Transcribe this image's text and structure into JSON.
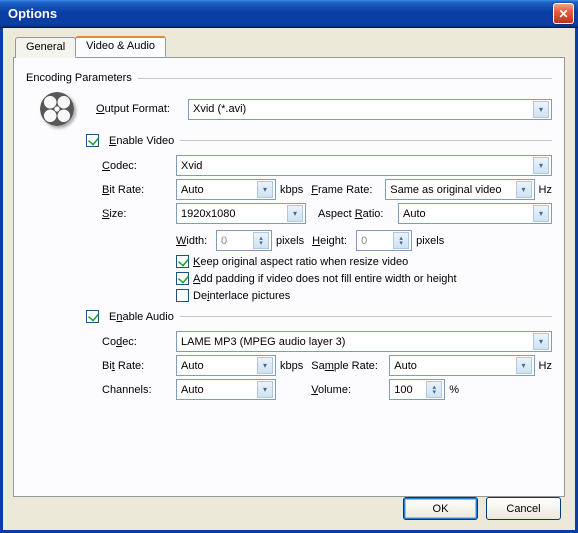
{
  "title": "Options",
  "tabs": {
    "general": "General",
    "video_audio": "Video & Audio"
  },
  "group_encoding": "Encoding Parameters",
  "output_format": {
    "label": "Output Format:",
    "value": "Xvid (*.avi)",
    "u": "O"
  },
  "video": {
    "enable": "Enable Video",
    "u_enable": "E",
    "codec": {
      "label": "Codec:",
      "value": "Xvid",
      "u": "C"
    },
    "bitrate": {
      "label": "Bit Rate:",
      "value": "Auto",
      "unit": "kbps",
      "u": "B"
    },
    "framerate": {
      "label": "Frame Rate:",
      "value": "Same as original video",
      "unit": "Hz",
      "u": "F"
    },
    "size": {
      "label": "Size:",
      "value": "1920x1080",
      "u": "S"
    },
    "aspect": {
      "label": "Aspect Ratio:",
      "value": "Auto",
      "u": "R"
    },
    "width": {
      "label": "Width:",
      "value": "0",
      "unit": "pixels",
      "u": "W"
    },
    "height": {
      "label": "Height:",
      "value": "0",
      "unit": "pixels",
      "u": "H"
    },
    "keep_ratio": "Keep original aspect ratio when resize video",
    "u_keep": "K",
    "add_padding": "Add padding if video does not fill entire width or height",
    "u_pad": "A",
    "deinterlace": "Deinterlace pictures",
    "u_dei": "i"
  },
  "audio": {
    "enable": "Enable Audio",
    "u_enable": "n",
    "codec": {
      "label": "Codec:",
      "value": "LAME MP3 (MPEG audio layer 3)",
      "u": "d"
    },
    "bitrate": {
      "label": "Bit Rate:",
      "value": "Auto",
      "unit": "kbps",
      "u": "t"
    },
    "samplerate": {
      "label": "Sample Rate:",
      "value": "Auto",
      "unit": "Hz",
      "u": "m"
    },
    "channels": {
      "label": "Channels:",
      "value": "Auto"
    },
    "volume": {
      "label": "Volume:",
      "value": "100",
      "unit": "%",
      "u": "V"
    }
  },
  "buttons": {
    "ok": "OK",
    "cancel": "Cancel"
  }
}
